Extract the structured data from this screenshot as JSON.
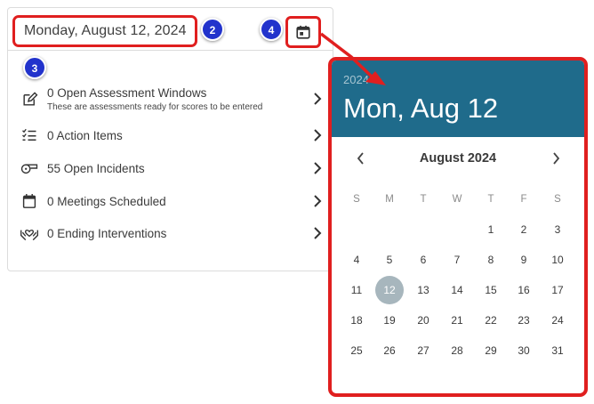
{
  "header": {
    "date_text": "Monday, August 12, 2024"
  },
  "badges": {
    "b2": "2",
    "b3": "3",
    "b4": "4"
  },
  "items": [
    {
      "label": "0 Open Assessment Windows",
      "sublabel": "These are assessments ready for scores to be entered",
      "icon": "edit-icon"
    },
    {
      "label": "0 Action Items",
      "icon": "checklist-icon"
    },
    {
      "label": "55 Open Incidents",
      "icon": "whistle-icon"
    },
    {
      "label": "0 Meetings Scheduled",
      "icon": "calendar-icon"
    },
    {
      "label": "0 Ending Interventions",
      "icon": "helping-hands-icon"
    }
  ],
  "datepicker": {
    "year": "2024",
    "selected_title": "Mon, Aug 12",
    "month_label": "August 2024",
    "weekdays": [
      "S",
      "M",
      "T",
      "W",
      "T",
      "F",
      "S"
    ],
    "first_weekday_index": 4,
    "days": [
      "1",
      "2",
      "3",
      "4",
      "5",
      "6",
      "7",
      "8",
      "9",
      "10",
      "11",
      "12",
      "13",
      "14",
      "15",
      "16",
      "17",
      "18",
      "19",
      "20",
      "21",
      "22",
      "23",
      "24",
      "25",
      "26",
      "27",
      "28",
      "29",
      "30",
      "31"
    ],
    "selected_day": "12"
  },
  "colors": {
    "header_bg": "#1f6b8b",
    "highlight_red": "#e01f1f",
    "badge_blue": "#2233cc",
    "selected_day_bg": "#a7b6bd"
  }
}
